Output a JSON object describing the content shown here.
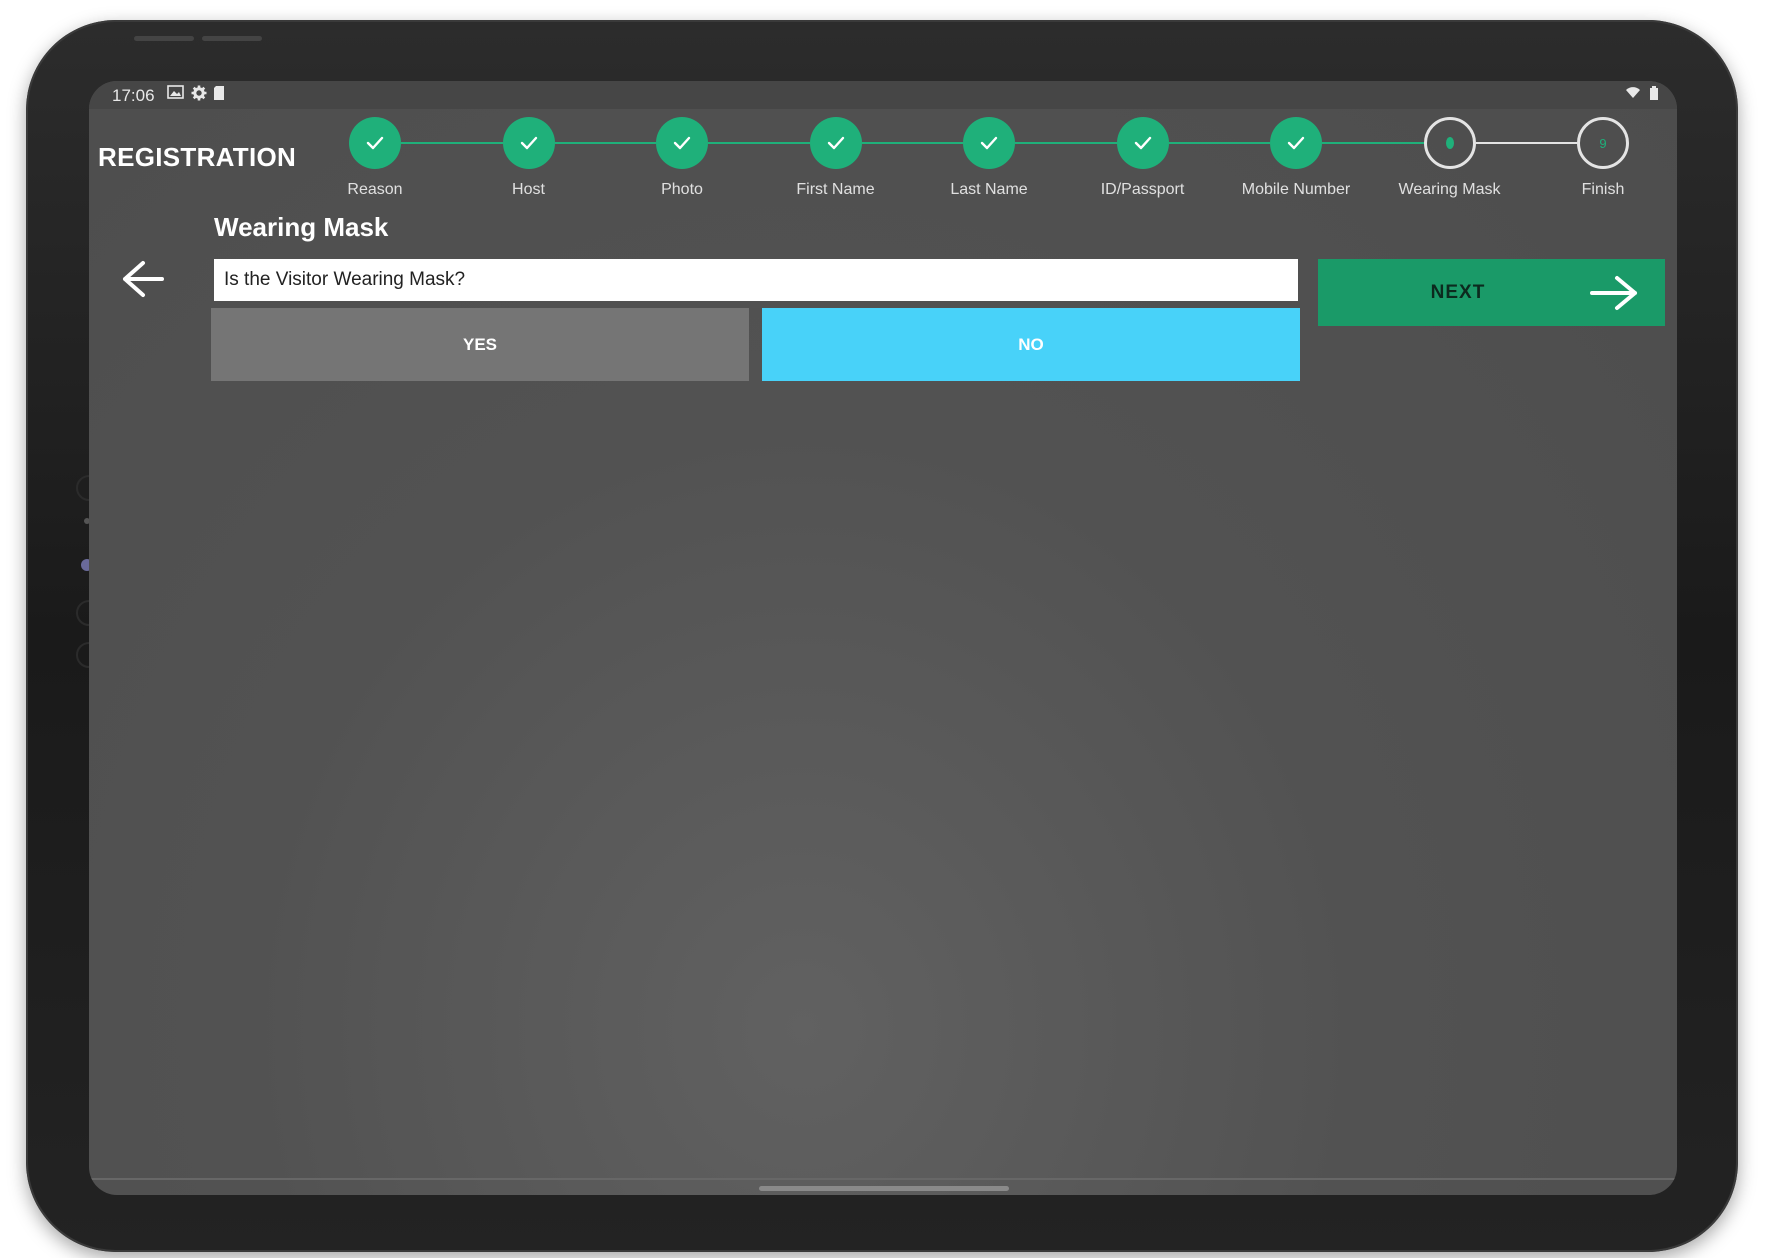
{
  "status_bar": {
    "time": "17:06",
    "icons": [
      "image-icon",
      "gear-icon",
      "sd-card-icon",
      "wifi-icon",
      "battery-icon"
    ]
  },
  "header": {
    "title": "REGISTRATION"
  },
  "stepper": {
    "steps": [
      {
        "label": "Reason",
        "state": "done"
      },
      {
        "label": "Host",
        "state": "done"
      },
      {
        "label": "Photo",
        "state": "done"
      },
      {
        "label": "First Name",
        "state": "done"
      },
      {
        "label": "Last Name",
        "state": "done"
      },
      {
        "label": "ID/Passport",
        "state": "done"
      },
      {
        "label": "Mobile Number",
        "state": "done"
      },
      {
        "label": "Wearing Mask",
        "state": "current"
      },
      {
        "label": "Finish",
        "state": "pending",
        "number": "9"
      }
    ],
    "done_color": "#1fb07a"
  },
  "question": {
    "title": "Wearing Mask",
    "prompt": "Is the Visitor Wearing Mask?",
    "yes_label": "YES",
    "no_label": "NO",
    "selected": "NO"
  },
  "actions": {
    "next_label": "NEXT"
  },
  "colors": {
    "accent_green": "#1a9a68",
    "selected_blue": "#48d2f9",
    "unselected_gray": "#757575",
    "screen_bg": "#525252"
  }
}
